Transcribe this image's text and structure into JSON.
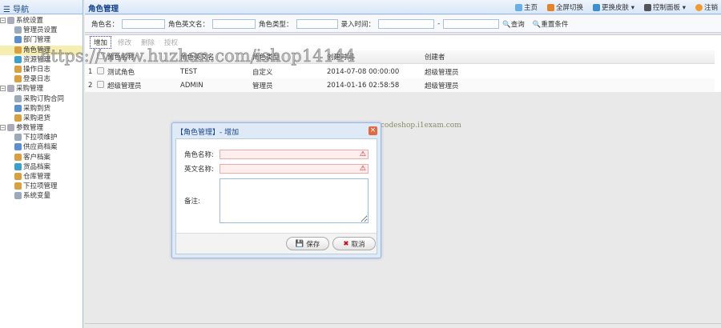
{
  "nav": {
    "title": "导航",
    "groups": [
      {
        "label": "系统设置",
        "items": [
          "管理员设置",
          "部门管理",
          "角色管理",
          "资源管理",
          "操作日志",
          "登录日志"
        ],
        "selected": 2
      },
      {
        "label": "采购管理",
        "items": [
          "采购订购合同",
          "采购到货",
          "采购退货"
        ]
      },
      {
        "label": "参数管理",
        "items": [
          "下拉项维护",
          "供应商档案",
          "客户档案",
          "货品档案",
          "仓库管理",
          "下拉项管理",
          "系统变量"
        ]
      }
    ]
  },
  "header": {
    "title": "角色管理",
    "links": [
      "主页",
      "全屏切换",
      "更换皮肤",
      "控制面板",
      "注销"
    ]
  },
  "search": {
    "name_label": "角色名：",
    "en_label": "角色英文名：",
    "type_label": "角色类型：",
    "date_label": "录入时间：",
    "date_sep": "-",
    "query": "查询",
    "reset": "重置条件"
  },
  "toolbar": [
    "增加",
    "修改",
    "删除",
    "授权"
  ],
  "grid": {
    "columns": [
      "角色名称",
      "角色英文名",
      "角色类型",
      "创建时间",
      "创建者"
    ],
    "rows": [
      {
        "num": "1",
        "name": "测试角色",
        "en": "TEST",
        "type": "自定义",
        "time": "2014-07-08 00:00:00",
        "creator": "超级管理员"
      },
      {
        "num": "2",
        "name": "超级管理员",
        "en": "ADMIN",
        "type": "管理员",
        "time": "2014-01-16 02:58:58",
        "creator": "超级管理员"
      }
    ]
  },
  "dialog": {
    "title": "【角色管理】- 增加",
    "name_label": "角色名称:",
    "en_label": "英文名称:",
    "remark_label": "备注:",
    "save": "保存",
    "cancel": "取消"
  },
  "watermarks": [
    "https://www.huzhan.com/ishop14144",
    "codeshop.i1exam.com"
  ]
}
